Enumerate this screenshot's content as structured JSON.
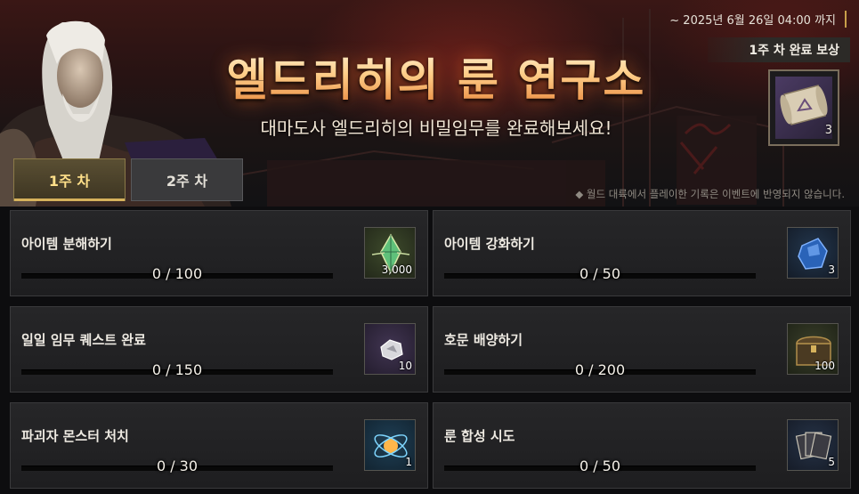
{
  "event": {
    "deadline": "~ 2025년 6월 26일 04:00 까지",
    "title": "엘드리히의 룬 연구소",
    "subtitle": "대마도사 엘드리히의 비밀임무를 완료해보세요!",
    "notice": "◆ 월드 대륙에서 플레이한 기록은 이벤트에 반영되지 않습니다.",
    "accent_color": "#c9a04a"
  },
  "weekly_reward": {
    "title": "1주 차 완료 보상",
    "icon": "scroll-icon",
    "count": "3"
  },
  "tabs": [
    {
      "label": "1주 차",
      "selected": true
    },
    {
      "label": "2주 차",
      "selected": false
    }
  ],
  "missions": [
    {
      "label": "아이템 분해하기",
      "progress_text": "0 / 100",
      "progress": 0,
      "target": 100,
      "reward_icon": "green-crystal-icon",
      "reward_count": "3,000"
    },
    {
      "label": "아이템 강화하기",
      "progress_text": "0 / 50",
      "progress": 0,
      "target": 50,
      "reward_icon": "blue-gem-icon",
      "reward_count": "3"
    },
    {
      "label": "일일 임무 퀘스트 완료",
      "progress_text": "0 / 150",
      "progress": 0,
      "target": 150,
      "reward_icon": "silver-ore-icon",
      "reward_count": "10"
    },
    {
      "label": "호문 배양하기",
      "progress_text": "0 / 200",
      "progress": 0,
      "target": 200,
      "reward_icon": "treasure-chest-icon",
      "reward_count": "100"
    },
    {
      "label": "파괴자 몬스터 처치",
      "progress_text": "0 / 30",
      "progress": 0,
      "target": 30,
      "reward_icon": "energy-orb-icon",
      "reward_count": "1"
    },
    {
      "label": "룬 합성 시도",
      "progress_text": "0 / 50",
      "progress": 0,
      "target": 50,
      "reward_icon": "rune-cards-icon",
      "reward_count": "5"
    }
  ]
}
